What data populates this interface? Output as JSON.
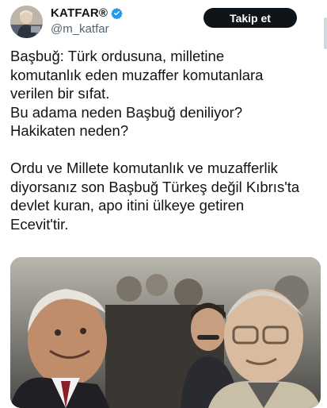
{
  "user": {
    "display_name": "KATFAR®",
    "handle": "@m_katfar",
    "verified": true,
    "verified_color": "#1d9bf0"
  },
  "follow_button": {
    "label": "Takip et"
  },
  "tweet": {
    "paragraph1": [
      "Başbuğ: Türk ordusuna, milletine",
      "komutanlık eden muzaffer komutanlara",
      "verilen bir sıfat.",
      "Bu adama neden Başbuğ deniliyor?",
      "Hakikaten neden?"
    ],
    "paragraph2": [
      "Ordu ve Millete komutanlık ve muzafferlik",
      "diyorsanız son Başbuğ Türkeş değil Kıbrıs'ta",
      "devlet kuran, apo itini ülkeye getiren",
      "Ecevit'tir."
    ]
  },
  "media": {
    "kind": "photo"
  },
  "colors": {
    "text": "#0f1419",
    "secondary": "#536471",
    "button_bg": "#0f1419"
  }
}
